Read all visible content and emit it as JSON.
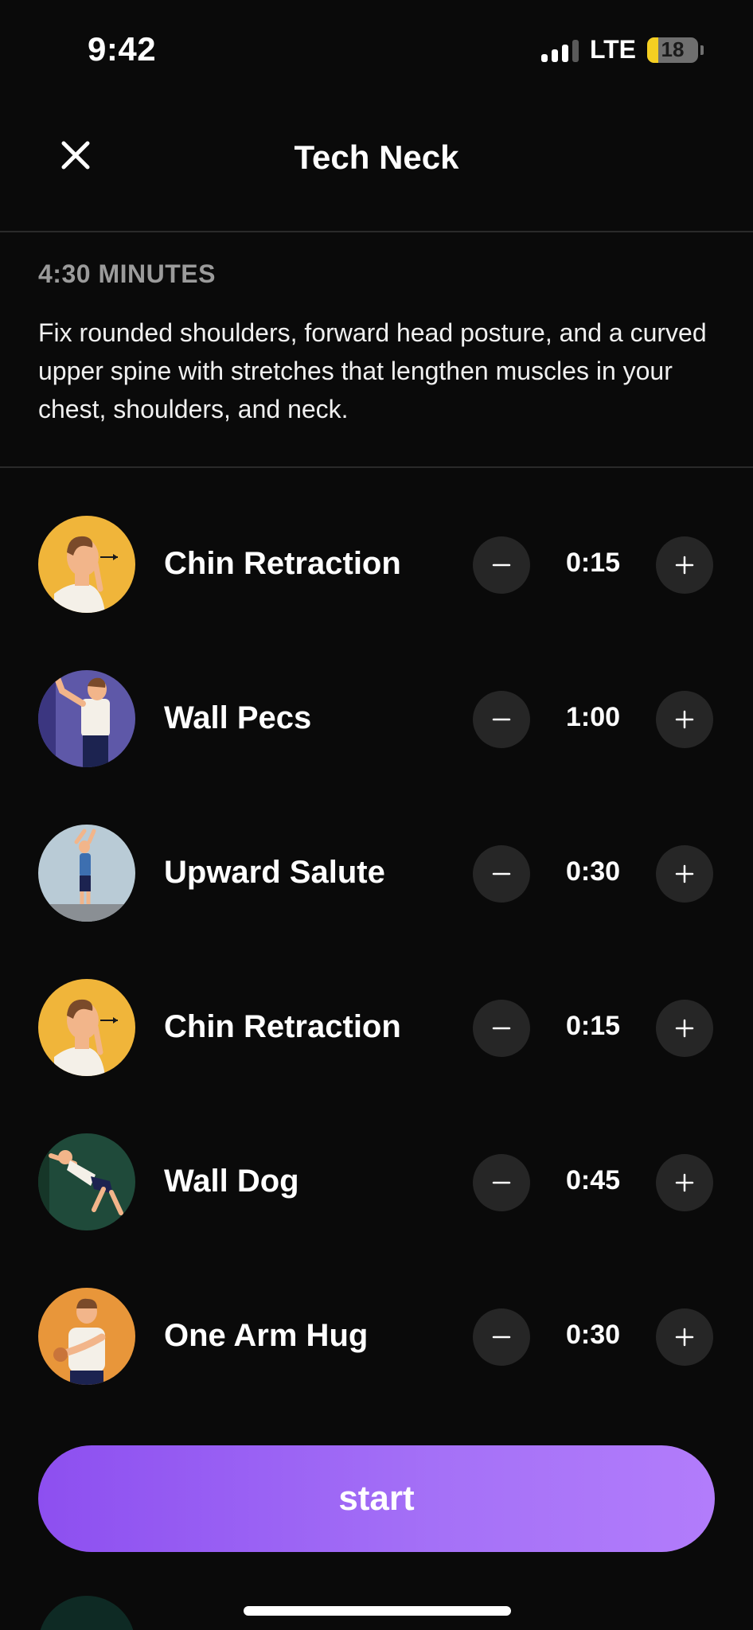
{
  "status_bar": {
    "time": "9:42",
    "network": "LTE",
    "battery": "18"
  },
  "header": {
    "title": "Tech Neck",
    "close_icon": "close-icon"
  },
  "summary": {
    "duration": "4:30 MINUTES",
    "description": "Fix rounded shoulders, forward head posture, and a curved upper spine with stretches that lengthen muscles in your chest, shoulders, and neck."
  },
  "exercises": [
    {
      "name": "Chin Retraction",
      "time": "0:15",
      "avatar_color": "#f0b53a"
    },
    {
      "name": "Wall Pecs",
      "time": "1:00",
      "avatar_color": "#5e58a8"
    },
    {
      "name": "Upward Salute",
      "time": "0:30",
      "avatar_color": "#b9cbd6"
    },
    {
      "name": "Chin Retraction",
      "time": "0:15",
      "avatar_color": "#f0b53a"
    },
    {
      "name": "Wall Dog",
      "time": "0:45",
      "avatar_color": "#1f4a3a"
    },
    {
      "name": "One Arm Hug",
      "time": "0:30",
      "avatar_color": "#e8963a"
    }
  ],
  "actions": {
    "start_label": "start"
  },
  "colors": {
    "background": "#0a0a0a",
    "accent_start": "#8d4ff0",
    "accent_end": "#b27cfb",
    "stepper_bg": "#262626",
    "muted_text": "#9b9b9b"
  }
}
